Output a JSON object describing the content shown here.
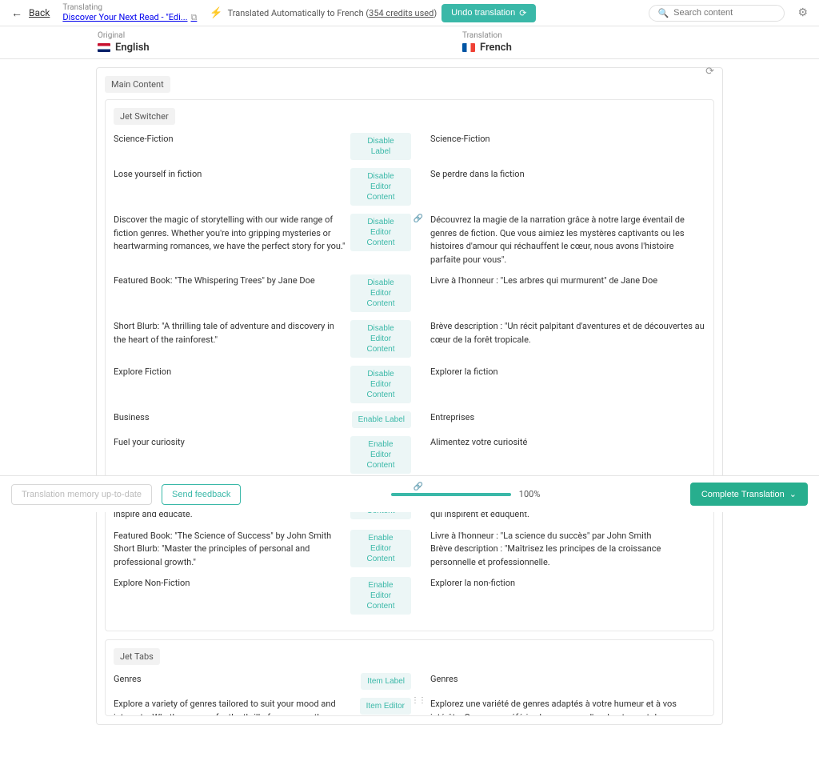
{
  "topbar": {
    "back": "Back",
    "translating_label": "Translating",
    "doc_title": "Discover Your Next Read - \"Edi...",
    "auto_text_pre": "Translated Automatically to French (",
    "credits": "354 credits used",
    "auto_text_post": ")",
    "undo": "Undo translation",
    "search_placeholder": "Search content"
  },
  "langs": {
    "orig_label": "Original",
    "orig_name": "English",
    "trans_label": "Translation",
    "trans_name": "French"
  },
  "main_section": "Main Content",
  "jet_switcher": "Jet Switcher",
  "jet_tabs": "Jet Tabs",
  "actions": {
    "disable_label": "Disable Label",
    "disable_editor": "Disable Editor Content",
    "enable_label": "Enable Label",
    "enable_editor": "Enable Editor Content",
    "item_label": "Item Label",
    "item_editor": "Item Editor"
  },
  "rows": [
    {
      "l": "Science-Fiction",
      "a": "disable_label",
      "r": "Science-Fiction"
    },
    {
      "l": "Lose yourself in fiction",
      "a": "disable_editor",
      "r": "Se perdre dans la fiction"
    },
    {
      "l": "Discover the magic of storytelling with our wide range of fiction genres. Whether you're into gripping mysteries or heartwarming romances, we have the perfect story for you.\"",
      "a": "disable_editor",
      "r": "Découvrez la magie de la narration grâce à notre large éventail de genres de fiction. Que vous aimiez les mystères captivants ou les histoires d'amour qui réchauffent le cœur, nous avons l'histoire parfaite pour vous\".",
      "link": true,
      "wrap": true
    },
    {
      "l": "Featured Book: \"The Whispering Trees\" by Jane Doe",
      "a": "disable_editor",
      "r": "Livre à l'honneur : \"Les arbres qui murmurent\" de Jane Doe"
    },
    {
      "l": "Short Blurb: \"A thrilling tale of adventure and discovery in the heart of the rainforest.\"",
      "a": "disable_editor",
      "r": "Brève description : \"Un récit palpitant d'aventures et de découvertes au cœur de la forêt tropicale.",
      "wrap": true
    },
    {
      "l": "Explore Fiction",
      "a": "disable_editor",
      "r": "Explorer la fiction"
    },
    {
      "l": "Business",
      "a": "enable_label",
      "r": "Entreprises"
    },
    {
      "l": "Fuel your curiosity",
      "a": "enable_editor",
      "r": "Alimentez votre curiosité"
    },
    {
      "l": "Expand your knowledge with our curated collection of non-fiction titles. From self-help to history, uncover books that inspire and educate.",
      "a": "enable_editor",
      "r": "Élargissez vos connaissances grâce à notre collection d'ouvrages non romanesques. De l'auto-assistance à l'histoire, découvrez des livres qui inspirent et éduquent.",
      "link": true,
      "wrap": true
    },
    {
      "l": "Featured Book: \"The Science of Success\" by John Smith\nShort Blurb: \"Master the principles of personal and professional growth.\"",
      "a": "enable_editor",
      "r": "Livre à l'honneur : \"La science du succès\" par John Smith\nBrève description : \"Maîtrisez les principes de la croissance personnelle et professionnelle."
    },
    {
      "l": "Explore Non-Fiction",
      "a": "enable_editor",
      "r": "Explorer la non-fiction"
    }
  ],
  "tabs_rows": [
    {
      "l": "Genres",
      "a": "item_label",
      "r": "Genres"
    },
    {
      "l": "Explore a variety of genres tailored to suit your mood and interests. Whether you prefer the thrill of suspense, the enchantment of fantasy, or the wisdom of non-fiction, there's something here",
      "a": "item_editor",
      "r": "Explorez une variété de genres adaptés à votre humeur et à vos intérêts. Que vous préfériez le suspense, l'enchantement du fantastique ou la sagesse de la non-fiction, il y en a pour tous les goûts. Sélectionnez",
      "dots": true
    }
  ],
  "bottom": {
    "memory": "Translation memory up-to-date",
    "feedback": "Send feedback",
    "progress": "100%",
    "complete": "Complete Translation"
  }
}
